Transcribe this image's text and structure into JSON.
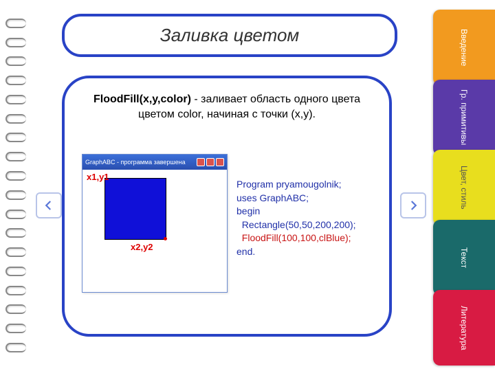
{
  "title": "Заливка цветом",
  "desc_bold": "FloodFill(x,y,color)",
  "desc_rest": " - заливает область одного цвета цветом color, начиная с точки (x,y).",
  "window_title": "GraphABC - программа завершена",
  "labels": {
    "p1": "x1,y1",
    "p2": "x2,y2"
  },
  "code": {
    "l1": "Program pryamougolnik;",
    "l2": "uses GraphABC;",
    "l3": "begin",
    "l4": "Rectangle(50,50,200,200);",
    "l5": "FloodFill(100,100,clBlue);",
    "l6": "end."
  },
  "tabs": {
    "t1": "Введение",
    "t2": "Гр. примитивы",
    "t3": "Цвет, стиль",
    "t4": "Текст",
    "t5": "Литература"
  }
}
